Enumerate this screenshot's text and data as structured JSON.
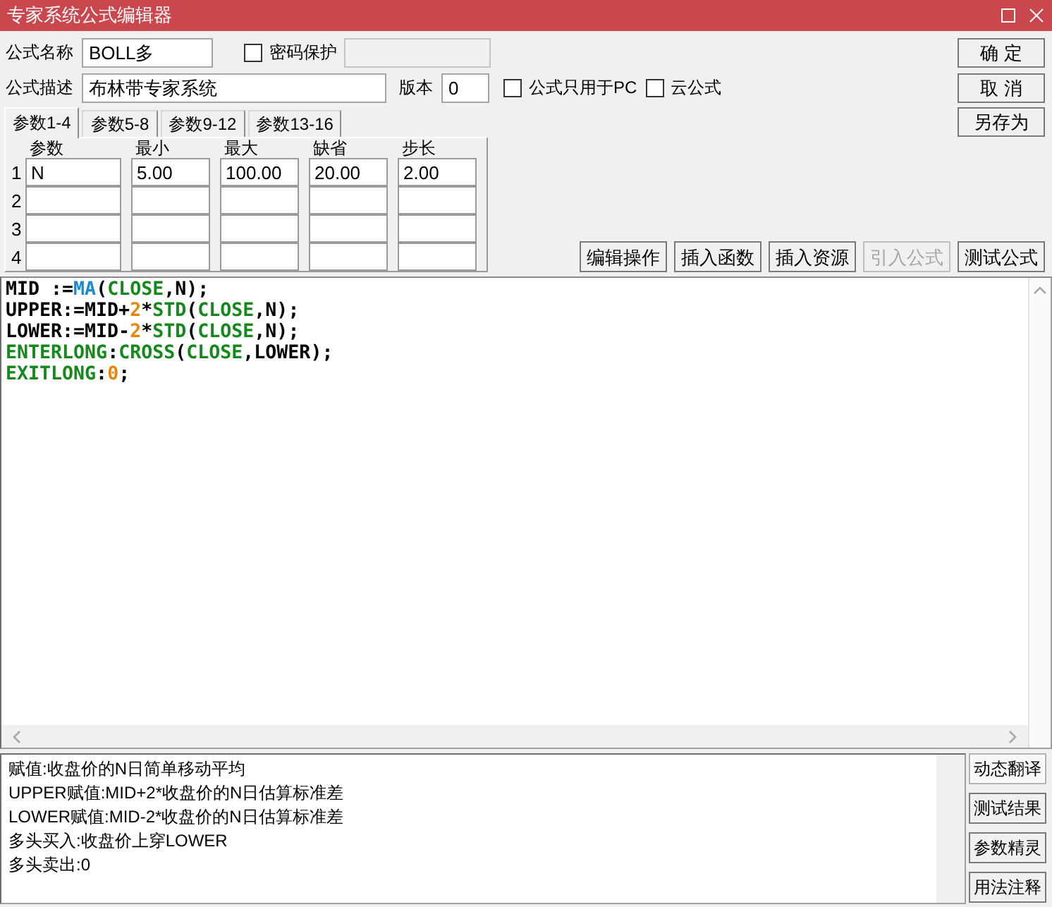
{
  "window": {
    "title": "专家系统公式编辑器"
  },
  "form": {
    "name_label": "公式名称",
    "name_value": "BOLL多",
    "password_checkbox": {
      "label": "密码保护",
      "checked": false
    },
    "password_field": {
      "disabled": true
    },
    "description_label": "公式描述",
    "description_value": "布林带专家系统",
    "version_label": "版本",
    "version_value": "0",
    "pc_only_checkbox": {
      "label": "公式只用于PC",
      "checked": false
    },
    "cloud_checkbox": {
      "label": "云公式",
      "checked": false
    }
  },
  "side_buttons": [
    {
      "label": "确 定"
    },
    {
      "label": "取 消"
    },
    {
      "label": "另存为"
    }
  ],
  "param_tabs": [
    {
      "label": "参数1-4",
      "selected": true
    },
    {
      "label": "参数5-8",
      "selected": false
    },
    {
      "label": "参数9-12",
      "selected": false
    },
    {
      "label": "参数13-16",
      "selected": false
    }
  ],
  "params": {
    "columns": [
      "参数",
      "最小",
      "最大",
      "缺省",
      "步长"
    ],
    "rows": [
      {
        "number": "1",
        "cells": [
          "N",
          "5.00",
          "100.00",
          "20.00",
          "2.00"
        ]
      },
      {
        "number": "2"
      },
      {
        "number": "3"
      },
      {
        "number": "4"
      }
    ]
  },
  "toolbar": [
    {
      "label": "编辑操作",
      "disabled": false
    },
    {
      "label": "插入函数",
      "disabled": false
    },
    {
      "label": "插入资源",
      "disabled": false
    },
    {
      "label": "引入公式",
      "disabled": true
    },
    {
      "label": "测试公式",
      "disabled": false
    }
  ],
  "code": {
    "lines": [
      {
        "tokens": [
          {
            "text": "MID :=",
            "kind": "plain"
          },
          {
            "text": "MA",
            "kind": "indicator"
          },
          {
            "text": "(",
            "kind": "plain"
          },
          {
            "text": "CLOSE",
            "kind": "keyword"
          },
          {
            "text": ",N);",
            "kind": "plain"
          }
        ]
      },
      {
        "tokens": [
          {
            "text": "UPPER:=MID+",
            "kind": "plain"
          },
          {
            "text": "2",
            "kind": "number"
          },
          {
            "text": "*",
            "kind": "plain"
          },
          {
            "text": "STD",
            "kind": "keyword"
          },
          {
            "text": "(",
            "kind": "plain"
          },
          {
            "text": "CLOSE",
            "kind": "keyword"
          },
          {
            "text": ",N);",
            "kind": "plain"
          }
        ]
      },
      {
        "tokens": [
          {
            "text": "LOWER:=MID-",
            "kind": "plain"
          },
          {
            "text": "2",
            "kind": "number"
          },
          {
            "text": "*",
            "kind": "plain"
          },
          {
            "text": "STD",
            "kind": "keyword"
          },
          {
            "text": "(",
            "kind": "plain"
          },
          {
            "text": "CLOSE",
            "kind": "keyword"
          },
          {
            "text": ",N);",
            "kind": "plain"
          }
        ]
      },
      {
        "tokens": [
          {
            "text": "ENTERLONG",
            "kind": "keyword"
          },
          {
            "text": ":",
            "kind": "plain"
          },
          {
            "text": "CROSS",
            "kind": "keyword"
          },
          {
            "text": "(",
            "kind": "plain"
          },
          {
            "text": "CLOSE",
            "kind": "keyword"
          },
          {
            "text": ",LOWER);",
            "kind": "plain"
          }
        ]
      },
      {
        "tokens": [
          {
            "text": "EXITLONG",
            "kind": "keyword"
          },
          {
            "text": ":",
            "kind": "plain"
          },
          {
            "text": "0",
            "kind": "number"
          },
          {
            "text": ";",
            "kind": "plain"
          }
        ]
      }
    ]
  },
  "translation": {
    "lines": [
      "赋值:收盘价的N日简单移动平均",
      "UPPER赋值:MID+2*收盘价的N日估算标准差",
      "LOWER赋值:MID-2*收盘价的N日估算标准差",
      "多头买入:收盘价上穿LOWER",
      "多头卖出:0"
    ]
  },
  "bottom_buttons": [
    {
      "label": "动态翻译",
      "selected": true
    },
    {
      "label": "测试结果",
      "selected": false
    },
    {
      "label": "参数精灵",
      "selected": false
    },
    {
      "label": "用法注释",
      "selected": false
    }
  ]
}
